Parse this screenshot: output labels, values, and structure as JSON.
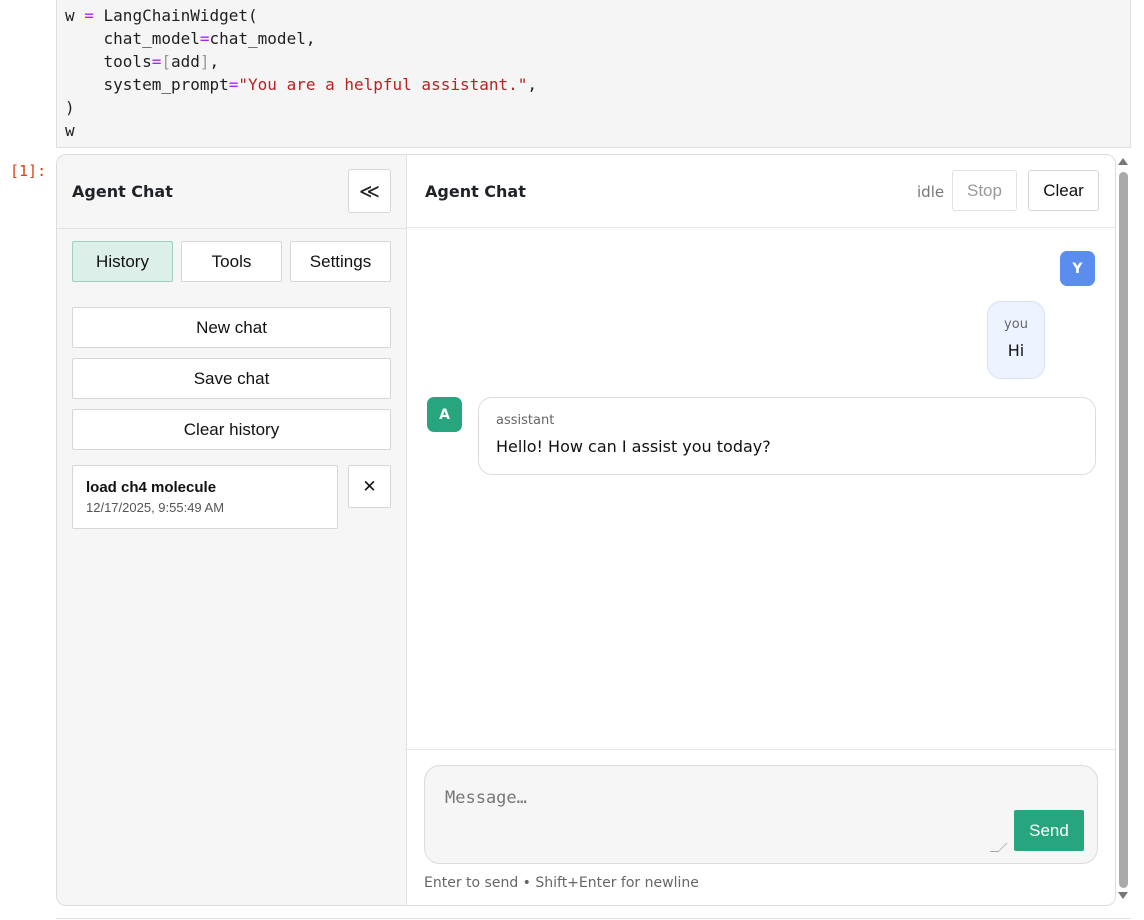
{
  "code": {
    "line1": {
      "a": "w ",
      "op": "=",
      "b": " LangChainWidget("
    },
    "line2": {
      "a": "    chat_model",
      "op": "=",
      "b": "chat_model,"
    },
    "line3": {
      "a": "    tools",
      "op": "=",
      "brk_open": "[",
      "b": "add",
      "brk_close": "]",
      "c": ","
    },
    "line4": {
      "a": "    system_prompt",
      "op": "=",
      "str": "\"You are a helpful assistant.\"",
      "c": ","
    },
    "line5": ")",
    "line6": "w"
  },
  "prompt": "[1]:",
  "sidebar": {
    "title": "Agent Chat",
    "collapse_glyph": "≪",
    "tabs": [
      {
        "label": "History",
        "active": true
      },
      {
        "label": "Tools",
        "active": false
      },
      {
        "label": "Settings",
        "active": false
      }
    ],
    "actions": {
      "new_chat": "New chat",
      "save_chat": "Save chat",
      "clear_history": "Clear history"
    },
    "history": [
      {
        "title": "load ch4 molecule",
        "date": "12/17/2025, 9:55:49 AM",
        "delete_glyph": "✕"
      }
    ]
  },
  "main": {
    "title": "Agent Chat",
    "status": "idle",
    "stop_label": "Stop",
    "clear_label": "Clear",
    "messages": [
      {
        "avatar": "Y",
        "role": "you",
        "text": "Hi"
      },
      {
        "avatar": "A",
        "role": "assistant",
        "text": "Hello! How can I assist you today?"
      }
    ],
    "composer": {
      "placeholder": "Message…",
      "send_label": "Send",
      "hint": "Enter to send • Shift+Enter for newline"
    }
  },
  "colors": {
    "accent": "#27a57f",
    "user_avatar": "#5b8def",
    "active_tab": "#dcefe8"
  }
}
